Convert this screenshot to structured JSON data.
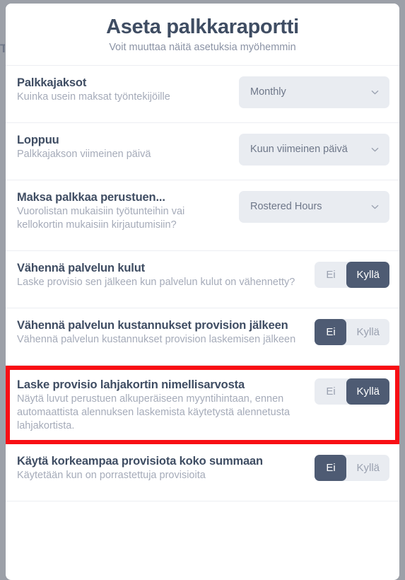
{
  "background": {
    "behind_text": "T",
    "overlay_color": "#9ca0a8"
  },
  "header": {
    "title": "Aseta palkkaraportti",
    "subtitle": "Voit muuttaa näitä asetuksia myöhemmin"
  },
  "colors": {
    "title": "#3f4d63",
    "muted": "#a5abb9",
    "control_bg": "#e9ecf1",
    "selected": "#4e5b73",
    "highlight": "#f80f14"
  },
  "rows": [
    {
      "label": "Palkkajaksot",
      "desc": "Kuinka usein maksat työntekijöille",
      "control": "select",
      "value": "Monthly"
    },
    {
      "label": "Loppuu",
      "desc": "Palkkajakson viimeinen päivä",
      "control": "select",
      "value": "Kuun viimeinen päivä"
    },
    {
      "label": "Maksa palkkaa perustuen...",
      "desc": "Vuorolistan mukaisiin työtunteihin vai kellokortin mukaisiin kirjautumisiin?",
      "control": "select",
      "value": "Rostered Hours"
    },
    {
      "label": "Vähennä palvelun kulut",
      "desc": "Laske provisio sen jälkeen kun palvelun kulut on vähennetty?",
      "control": "toggle",
      "no_label": "Ei",
      "yes_label": "Kyllä",
      "selected": "yes"
    },
    {
      "label": "Vähennä palvelun kustannukset provision jälkeen",
      "desc": "Vähennä palvelun kustannukset provision laskemisen jälkeen",
      "control": "toggle",
      "no_label": "Ei",
      "yes_label": "Kyllä",
      "selected": "no"
    },
    {
      "label": "Laske provisio lahjakortin nimellisarvosta",
      "desc": "Näytä luvut perustuen alkuperäiseen myyntihintaan, ennen automaattista alennuksen laskemista käytetystä alennetusta lahjakortista.",
      "control": "toggle",
      "no_label": "Ei",
      "yes_label": "Kyllä",
      "selected": "yes",
      "highlighted": true
    },
    {
      "label": "Käytä korkeampaa provisiota koko summaan",
      "desc": "Käytetään kun on porrastettuja provisioita",
      "control": "toggle",
      "no_label": "Ei",
      "yes_label": "Kyllä",
      "selected": "no"
    }
  ]
}
